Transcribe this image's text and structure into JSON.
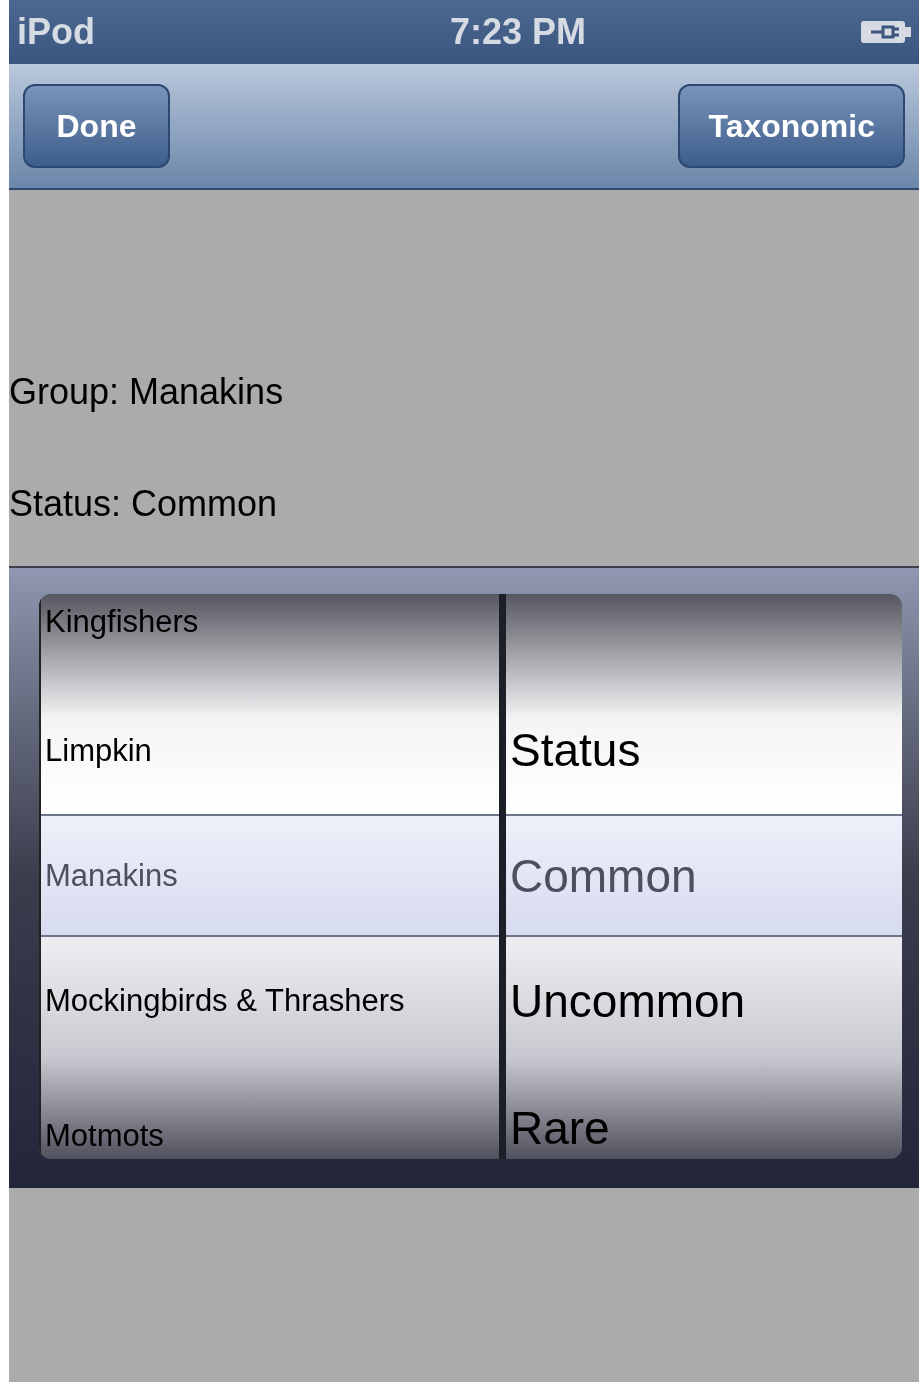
{
  "status_bar": {
    "carrier": "iPod",
    "time": "7:23 PM"
  },
  "nav_bar": {
    "left_button": "Done",
    "right_button": "Taxonomic"
  },
  "details": [
    "Group: Manakins",
    "Status: Common"
  ],
  "picker": {
    "columns": [
      {
        "items": [
          {
            "label": "Kingfishers",
            "selected": false
          },
          {
            "label": "Limpkin",
            "selected": false
          },
          {
            "label": "Manakins",
            "selected": true
          },
          {
            "label": "Mockingbirds & Thrashers",
            "selected": false
          },
          {
            "label": "Motmots",
            "selected": false
          }
        ]
      },
      {
        "items": [
          {
            "label": "Status",
            "selected": false
          },
          {
            "label": "Common",
            "selected": true
          },
          {
            "label": "Uncommon",
            "selected": false
          },
          {
            "label": "Rare",
            "selected": false
          }
        ]
      }
    ]
  }
}
